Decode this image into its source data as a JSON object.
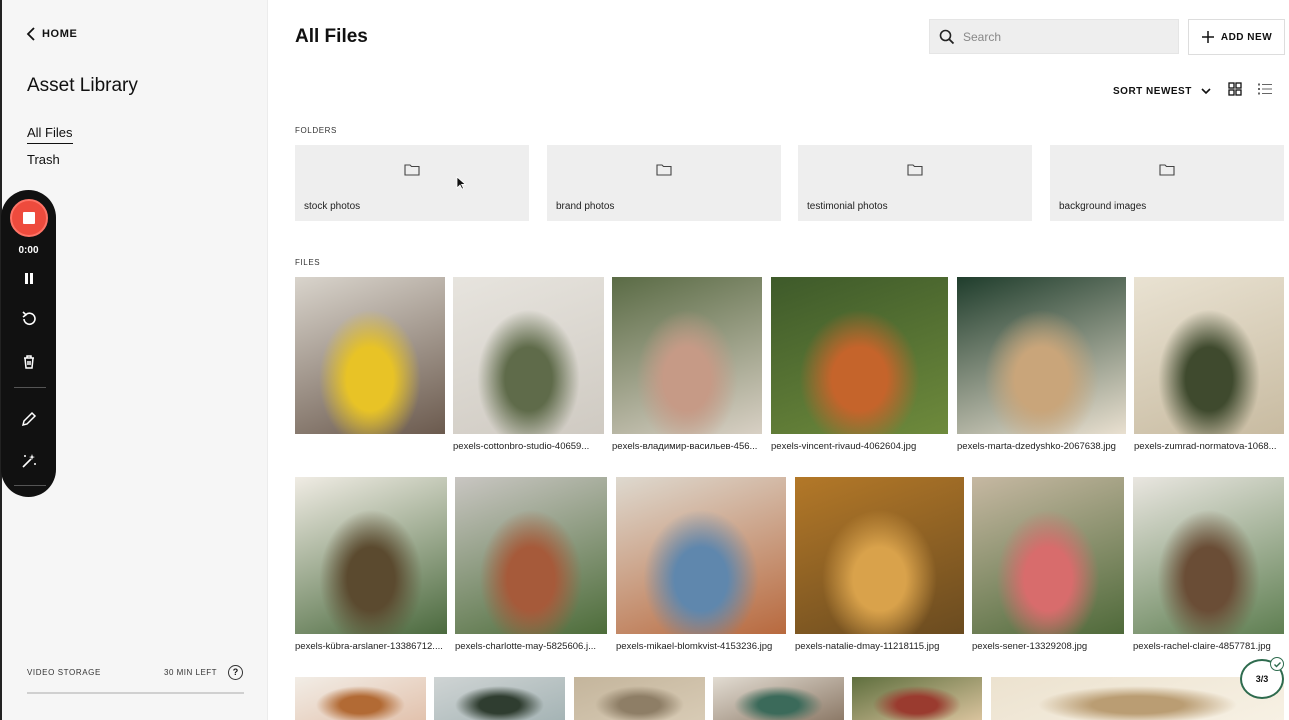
{
  "sidebar": {
    "back_label": "HOME",
    "title": "Asset Library",
    "nav": [
      {
        "label": "All Files",
        "active": true
      },
      {
        "label": "Trash",
        "active": false
      }
    ],
    "storage_label": "VIDEO STORAGE",
    "storage_left": "30 MIN LEFT"
  },
  "recorder": {
    "time": "0:00",
    "icons": [
      "stop-icon",
      "pause-icon",
      "restart-icon",
      "trash-icon",
      "pencil-icon",
      "magic-wand-icon"
    ]
  },
  "main": {
    "title": "All Files",
    "search_placeholder": "Search",
    "add_new_label": "ADD NEW",
    "sort_label": "SORT NEWEST",
    "folders_label": "FOLDERS",
    "files_label": "FILES",
    "folders": [
      {
        "name": "stock photos"
      },
      {
        "name": "brand photos"
      },
      {
        "name": "testimonial photos"
      },
      {
        "name": "background images"
      }
    ],
    "files_row1": [
      {
        "name": "",
        "colors": [
          "#d9d4cc",
          "#e8c326",
          "#6b5a4e"
        ]
      },
      {
        "name": "pexels-cottonbro-studio-40659...",
        "colors": [
          "#e7e4de",
          "#5f6b4a",
          "#cfcac2"
        ]
      },
      {
        "name": "pexels-владимир-васильев-456...",
        "colors": [
          "#5a6b45",
          "#c69a86",
          "#d8d0c4"
        ]
      },
      {
        "name": "pexels-vincent-rivaud-4062604.jpg",
        "colors": [
          "#3e5a2a",
          "#c5642b",
          "#6e8a3c"
        ]
      },
      {
        "name": "pexels-marta-dzedyshko-2067638.jpg",
        "colors": [
          "#1f3d2c",
          "#c9a57a",
          "#e9e0d0"
        ]
      },
      {
        "name": "pexels-zumrad-normatova-1068...",
        "colors": [
          "#e9e2d2",
          "#3f4a2e",
          "#c8bba1"
        ]
      }
    ],
    "files_row2": [
      {
        "name": "pexels-kübra-arslaner-13386712....",
        "colors": [
          "#f0ece4",
          "#5b4a2f",
          "#4b6a3e"
        ]
      },
      {
        "name": "pexels-charlotte-may-5825606.j...",
        "colors": [
          "#c9c6c2",
          "#a65a3a",
          "#4d6d3a"
        ]
      },
      {
        "name": "pexels-mikael-blomkvist-4153236.jpg",
        "colors": [
          "#ded9cf",
          "#5f87ad",
          "#b8693e"
        ]
      },
      {
        "name": "pexels-natalie-dmay-11218115.jpg",
        "colors": [
          "#b37828",
          "#d9a24b",
          "#6a4b20"
        ]
      },
      {
        "name": "pexels-sener-13329208.jpg",
        "colors": [
          "#c6b8a2",
          "#d86c6c",
          "#4f6a3a"
        ]
      },
      {
        "name": "pexels-rachel-claire-4857781.jpg",
        "colors": [
          "#e9e6e0",
          "#6a4d36",
          "#5f7f52"
        ]
      }
    ],
    "files_row3": [
      {
        "colors": [
          "#f2ede6",
          "#b26a34",
          "#e2c2ad"
        ]
      },
      {
        "colors": [
          "#cfd4d4",
          "#2f3d30",
          "#a5b4b5"
        ]
      },
      {
        "colors": [
          "#c4b59c",
          "#8e7e66",
          "#d8cbb5"
        ]
      },
      {
        "colors": [
          "#e2dcd2",
          "#3b6a5a",
          "#8d7a68"
        ]
      },
      {
        "colors": [
          "#5f6f3e",
          "#9a3b2f",
          "#d9c39d"
        ]
      },
      {
        "colors": [
          "#ece2cf",
          "#ba9d73",
          "#f7f1e4"
        ]
      }
    ],
    "progress_badge": "3/3"
  },
  "colors": {
    "record_red": "#ee4b3d",
    "badge_green": "#2e6b4e",
    "folder_bg": "#eeeeee"
  }
}
